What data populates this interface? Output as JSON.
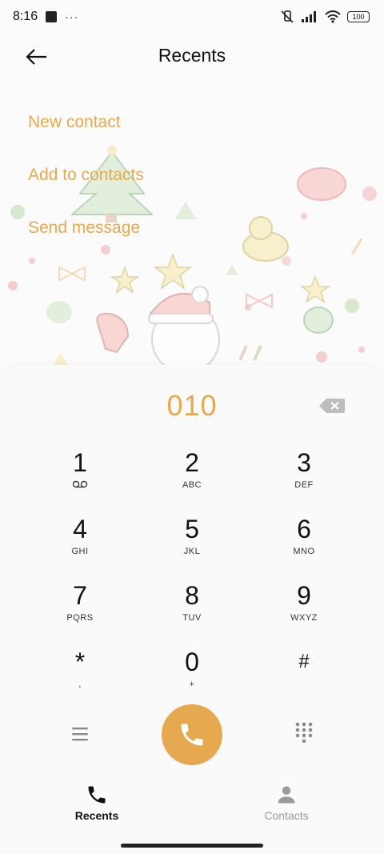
{
  "status_bar": {
    "time": "8:16",
    "dots": "···",
    "battery": "100"
  },
  "header": {
    "title": "Recents"
  },
  "actions": [
    {
      "label": "New contact"
    },
    {
      "label": "Add to contacts"
    },
    {
      "label": "Send message"
    }
  ],
  "dialer": {
    "number": "010",
    "keys": [
      {
        "digit": "1",
        "letters": ""
      },
      {
        "digit": "2",
        "letters": "ABC"
      },
      {
        "digit": "3",
        "letters": "DEF"
      },
      {
        "digit": "4",
        "letters": "GHI"
      },
      {
        "digit": "5",
        "letters": "JKL"
      },
      {
        "digit": "6",
        "letters": "MNO"
      },
      {
        "digit": "7",
        "letters": "PQRS"
      },
      {
        "digit": "8",
        "letters": "TUV"
      },
      {
        "digit": "9",
        "letters": "WXYZ"
      },
      {
        "digit": "*",
        "letters": ","
      },
      {
        "digit": "0",
        "letters": "+"
      },
      {
        "digit": "#",
        "letters": ""
      }
    ]
  },
  "bottom_nav": {
    "recents": "Recents",
    "contacts": "Contacts"
  },
  "colors": {
    "accent": "#e6a94f",
    "text": "#111111",
    "muted": "#9a9a9a"
  }
}
